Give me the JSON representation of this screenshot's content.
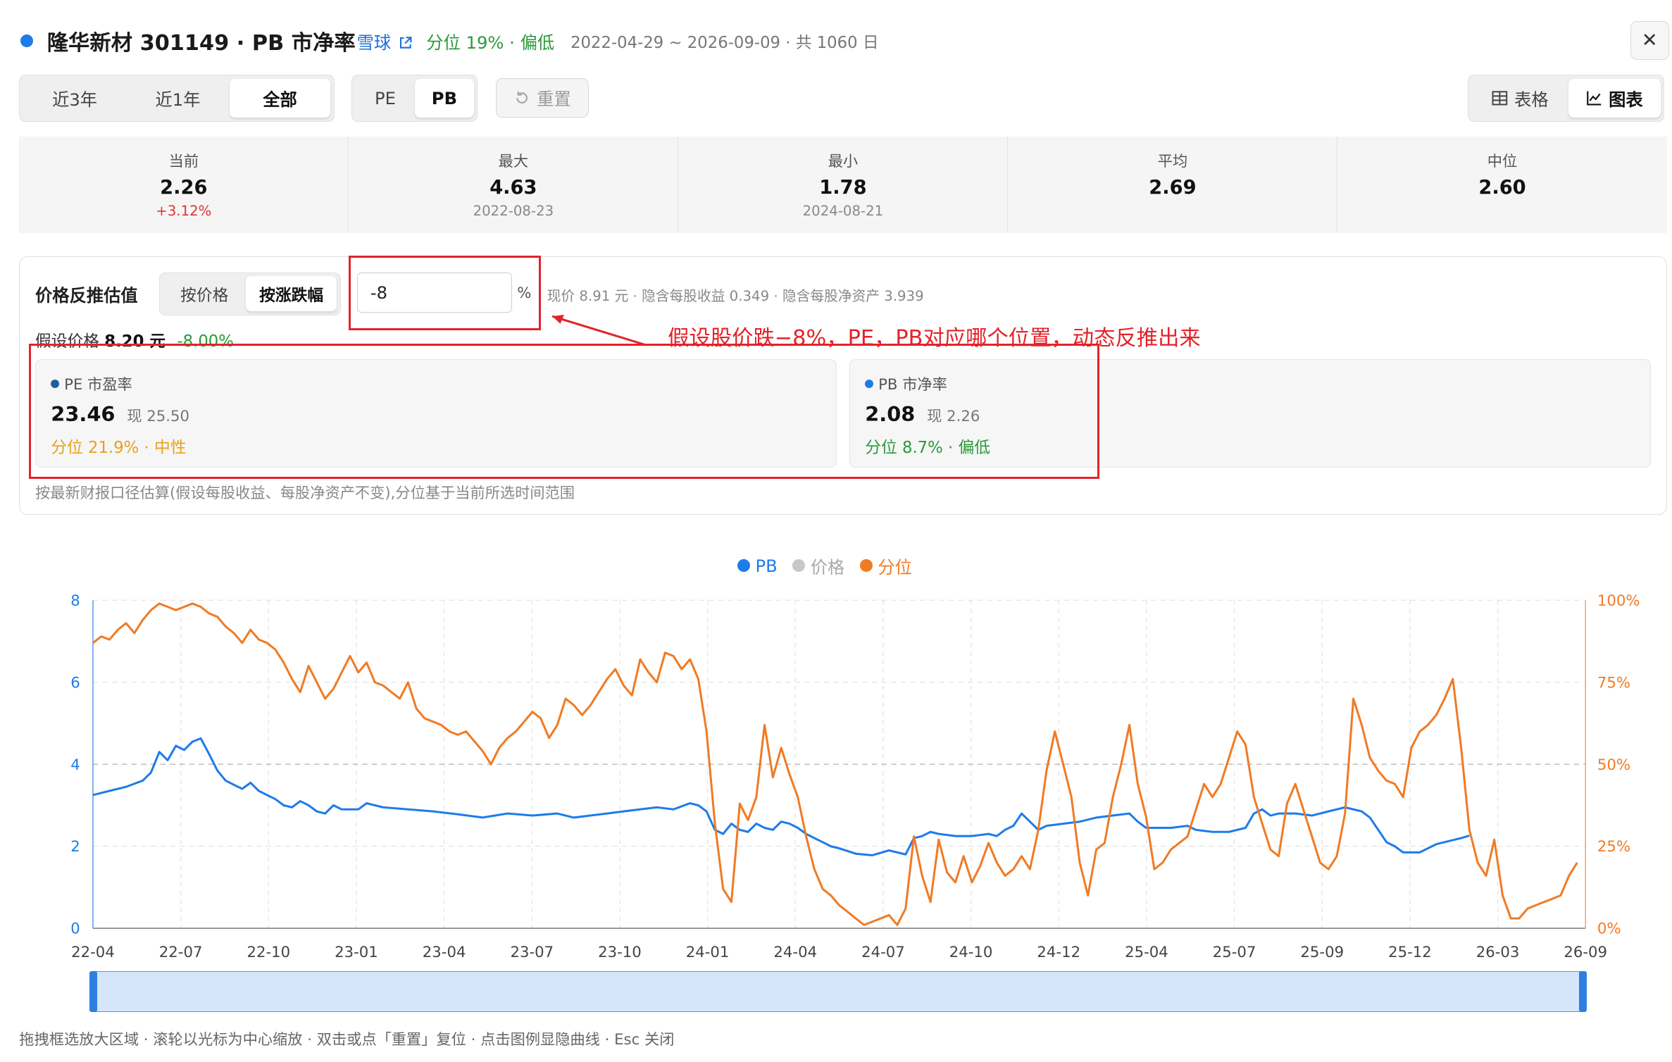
{
  "header": {
    "title": "隆华新材 301149 · PB 市净率",
    "source_link": "雪球",
    "percentile": "分位 19% · 偏低",
    "range": "2022-04-29 ~ 2026-09-09 · 共 1060 日",
    "close": "✕"
  },
  "toolbar": {
    "period_tabs": [
      "近3年",
      "近1年",
      "全部"
    ],
    "metric_tabs": [
      "PE",
      "PB"
    ],
    "reset": "重置",
    "view_table": "表格",
    "view_chart": "图表"
  },
  "stats": [
    {
      "label": "当前",
      "value": "2.26",
      "note": "+3.12%"
    },
    {
      "label": "最大",
      "value": "4.63",
      "note": "2022-08-23"
    },
    {
      "label": "最小",
      "value": "1.78",
      "note": "2024-08-21"
    },
    {
      "label": "平均",
      "value": "2.69",
      "note": ""
    },
    {
      "label": "中位",
      "value": "2.60",
      "note": ""
    }
  ],
  "valuation": {
    "title": "价格反推估值",
    "mode_tabs": [
      "按价格",
      "按涨跌幅"
    ],
    "input_value": "-8",
    "unit": "%",
    "info": "现价 8.91 元 · 隐含每股收益 0.349 · 隐含每股净资产 3.939",
    "assumed_label": "假设价格",
    "assumed_price": "8.20 元",
    "assumed_change": "-8.00%",
    "pe_card": {
      "head": "PE 市盈率",
      "value": "23.46",
      "now": "现 25.50",
      "pct": "分位 21.9% · 中性"
    },
    "pb_card": {
      "head": "PB 市净率",
      "value": "2.08",
      "now": "现 2.26",
      "pct": "分位 8.7% · 偏低"
    },
    "footnote": "按最新财报口径估算(假设每股收益、每股净资产不变),分位基于当前所选时间范围",
    "annotation": "假设股价跌−8%，PE，PB对应哪个位置，动态反推出来"
  },
  "colors": {
    "pb": "#1e7ce8",
    "price": "#bdbdbd",
    "pct": "#f07b25",
    "accent_red": "#e3232b",
    "green": "#2a9a3a",
    "orange_text": "#e8a01c"
  },
  "chart_data": {
    "type": "line",
    "legend": [
      "PB",
      "价格",
      "分位"
    ],
    "x_ticks": [
      "22-04",
      "22-07",
      "22-10",
      "23-01",
      "23-04",
      "23-07",
      "23-10",
      "24-01",
      "24-04",
      "24-07",
      "24-10",
      "24-12",
      "25-04",
      "25-07",
      "25-09",
      "25-12",
      "26-03",
      "26-09"
    ],
    "y_left_ticks": [
      "0",
      "2",
      "4",
      "6",
      "8"
    ],
    "y_right_ticks": [
      "0%",
      "25%",
      "50%",
      "75%",
      "100%"
    ],
    "ylim_left": [
      0,
      8
    ],
    "ylim_right": [
      0,
      100
    ],
    "series": [
      {
        "name": "PB",
        "axis": "left",
        "points": [
          [
            0,
            3.25
          ],
          [
            2,
            3.35
          ],
          [
            4,
            3.45
          ],
          [
            6,
            3.6
          ],
          [
            7,
            3.8
          ],
          [
            8,
            4.3
          ],
          [
            9,
            4.1
          ],
          [
            10,
            4.45
          ],
          [
            11,
            4.35
          ],
          [
            12,
            4.55
          ],
          [
            13,
            4.63
          ],
          [
            14,
            4.25
          ],
          [
            15,
            3.85
          ],
          [
            16,
            3.6
          ],
          [
            17,
            3.5
          ],
          [
            18,
            3.4
          ],
          [
            19,
            3.55
          ],
          [
            20,
            3.35
          ],
          [
            21,
            3.25
          ],
          [
            22,
            3.15
          ],
          [
            23,
            3.0
          ],
          [
            24,
            2.95
          ],
          [
            25,
            3.1
          ],
          [
            26,
            3.0
          ],
          [
            27,
            2.85
          ],
          [
            28,
            2.8
          ],
          [
            29,
            3.0
          ],
          [
            30,
            2.9
          ],
          [
            32,
            2.9
          ],
          [
            33,
            3.05
          ],
          [
            35,
            2.95
          ],
          [
            38,
            2.9
          ],
          [
            41,
            2.85
          ],
          [
            44,
            2.78
          ],
          [
            47,
            2.7
          ],
          [
            50,
            2.8
          ],
          [
            53,
            2.75
          ],
          [
            56,
            2.8
          ],
          [
            58,
            2.7
          ],
          [
            60,
            2.75
          ],
          [
            62,
            2.8
          ],
          [
            64,
            2.85
          ],
          [
            66,
            2.9
          ],
          [
            68,
            2.95
          ],
          [
            70,
            2.9
          ],
          [
            72,
            3.05
          ],
          [
            73,
            3.0
          ],
          [
            74,
            2.85
          ],
          [
            75,
            2.4
          ],
          [
            76,
            2.3
          ],
          [
            77,
            2.55
          ],
          [
            78,
            2.4
          ],
          [
            79,
            2.35
          ],
          [
            80,
            2.55
          ],
          [
            81,
            2.45
          ],
          [
            82,
            2.4
          ],
          [
            83,
            2.6
          ],
          [
            84,
            2.55
          ],
          [
            85,
            2.45
          ],
          [
            86,
            2.3
          ],
          [
            87,
            2.2
          ],
          [
            88,
            2.1
          ],
          [
            89,
            2.0
          ],
          [
            90,
            1.95
          ],
          [
            92,
            1.82
          ],
          [
            94,
            1.78
          ],
          [
            96,
            1.9
          ],
          [
            97,
            1.85
          ],
          [
            98,
            1.8
          ],
          [
            99,
            2.2
          ],
          [
            100,
            2.25
          ],
          [
            101,
            2.35
          ],
          [
            102,
            2.3
          ],
          [
            104,
            2.25
          ],
          [
            106,
            2.25
          ],
          [
            108,
            2.3
          ],
          [
            109,
            2.25
          ],
          [
            110,
            2.4
          ],
          [
            111,
            2.5
          ],
          [
            112,
            2.8
          ],
          [
            113,
            2.6
          ],
          [
            114,
            2.4
          ],
          [
            115,
            2.5
          ],
          [
            117,
            2.55
          ],
          [
            119,
            2.6
          ],
          [
            121,
            2.7
          ],
          [
            123,
            2.75
          ],
          [
            125,
            2.8
          ],
          [
            126,
            2.6
          ],
          [
            127,
            2.45
          ],
          [
            128,
            2.45
          ],
          [
            130,
            2.45
          ],
          [
            132,
            2.5
          ],
          [
            133,
            2.4
          ],
          [
            135,
            2.35
          ],
          [
            137,
            2.35
          ],
          [
            139,
            2.45
          ],
          [
            140,
            2.8
          ],
          [
            141,
            2.9
          ],
          [
            142,
            2.75
          ],
          [
            143,
            2.8
          ],
          [
            145,
            2.8
          ],
          [
            147,
            2.75
          ],
          [
            149,
            2.85
          ],
          [
            151,
            2.95
          ],
          [
            153,
            2.85
          ],
          [
            154,
            2.7
          ],
          [
            155,
            2.4
          ],
          [
            156,
            2.1
          ],
          [
            157,
            2.0
          ],
          [
            158,
            1.85
          ],
          [
            160,
            1.85
          ],
          [
            162,
            2.05
          ],
          [
            164,
            2.15
          ],
          [
            165,
            2.2
          ],
          [
            166,
            2.26
          ]
        ]
      },
      {
        "name": "分位",
        "axis": "right",
        "points": [
          [
            0,
            87
          ],
          [
            1,
            89
          ],
          [
            2,
            88
          ],
          [
            3,
            91
          ],
          [
            4,
            93
          ],
          [
            5,
            90
          ],
          [
            6,
            94
          ],
          [
            7,
            97
          ],
          [
            8,
            99
          ],
          [
            9,
            98
          ],
          [
            10,
            97
          ],
          [
            11,
            98
          ],
          [
            12,
            99
          ],
          [
            13,
            98
          ],
          [
            14,
            96
          ],
          [
            15,
            95
          ],
          [
            16,
            92
          ],
          [
            17,
            90
          ],
          [
            18,
            87
          ],
          [
            19,
            91
          ],
          [
            20,
            88
          ],
          [
            21,
            87
          ],
          [
            22,
            85
          ],
          [
            23,
            81
          ],
          [
            24,
            76
          ],
          [
            25,
            72
          ],
          [
            26,
            80
          ],
          [
            27,
            75
          ],
          [
            28,
            70
          ],
          [
            29,
            73
          ],
          [
            30,
            78
          ],
          [
            31,
            83
          ],
          [
            32,
            78
          ],
          [
            33,
            81
          ],
          [
            34,
            75
          ],
          [
            35,
            74
          ],
          [
            36,
            72
          ],
          [
            37,
            70
          ],
          [
            38,
            75
          ],
          [
            39,
            67
          ],
          [
            40,
            64
          ],
          [
            41,
            63
          ],
          [
            42,
            62
          ],
          [
            43,
            60
          ],
          [
            44,
            59
          ],
          [
            45,
            60
          ],
          [
            46,
            57
          ],
          [
            47,
            54
          ],
          [
            48,
            50
          ],
          [
            49,
            55
          ],
          [
            50,
            58
          ],
          [
            51,
            60
          ],
          [
            52,
            63
          ],
          [
            53,
            66
          ],
          [
            54,
            64
          ],
          [
            55,
            58
          ],
          [
            56,
            62
          ],
          [
            57,
            70
          ],
          [
            58,
            68
          ],
          [
            59,
            65
          ],
          [
            60,
            68
          ],
          [
            61,
            72
          ],
          [
            62,
            76
          ],
          [
            63,
            79
          ],
          [
            64,
            74
          ],
          [
            65,
            71
          ],
          [
            66,
            82
          ],
          [
            67,
            78
          ],
          [
            68,
            75
          ],
          [
            69,
            84
          ],
          [
            70,
            83
          ],
          [
            71,
            79
          ],
          [
            72,
            82
          ],
          [
            73,
            76
          ],
          [
            74,
            60
          ],
          [
            75,
            32
          ],
          [
            76,
            12
          ],
          [
            77,
            8
          ],
          [
            78,
            38
          ],
          [
            79,
            33
          ],
          [
            80,
            40
          ],
          [
            81,
            62
          ],
          [
            82,
            46
          ],
          [
            83,
            55
          ],
          [
            84,
            47
          ],
          [
            85,
            40
          ],
          [
            86,
            28
          ],
          [
            87,
            18
          ],
          [
            88,
            12
          ],
          [
            89,
            10
          ],
          [
            90,
            7
          ],
          [
            91,
            5
          ],
          [
            92,
            3
          ],
          [
            93,
            1
          ],
          [
            94,
            2
          ],
          [
            95,
            3
          ],
          [
            96,
            4
          ],
          [
            97,
            1
          ],
          [
            98,
            6
          ],
          [
            99,
            28
          ],
          [
            100,
            16
          ],
          [
            101,
            8
          ],
          [
            102,
            27
          ],
          [
            103,
            17
          ],
          [
            104,
            14
          ],
          [
            105,
            22
          ],
          [
            106,
            14
          ],
          [
            107,
            19
          ],
          [
            108,
            26
          ],
          [
            109,
            20
          ],
          [
            110,
            16
          ],
          [
            111,
            18
          ],
          [
            112,
            22
          ],
          [
            113,
            18
          ],
          [
            114,
            30
          ],
          [
            115,
            48
          ],
          [
            116,
            60
          ],
          [
            117,
            50
          ],
          [
            118,
            40
          ],
          [
            119,
            20
          ],
          [
            120,
            10
          ],
          [
            121,
            24
          ],
          [
            122,
            26
          ],
          [
            123,
            40
          ],
          [
            124,
            50
          ],
          [
            125,
            62
          ],
          [
            126,
            44
          ],
          [
            127,
            34
          ],
          [
            128,
            18
          ],
          [
            129,
            20
          ],
          [
            130,
            24
          ],
          [
            131,
            26
          ],
          [
            132,
            28
          ],
          [
            133,
            36
          ],
          [
            134,
            44
          ],
          [
            135,
            40
          ],
          [
            136,
            44
          ],
          [
            137,
            52
          ],
          [
            138,
            60
          ],
          [
            139,
            56
          ],
          [
            140,
            40
          ],
          [
            141,
            32
          ],
          [
            142,
            24
          ],
          [
            143,
            22
          ],
          [
            144,
            38
          ],
          [
            145,
            44
          ],
          [
            146,
            36
          ],
          [
            147,
            28
          ],
          [
            148,
            20
          ],
          [
            149,
            18
          ],
          [
            150,
            22
          ],
          [
            151,
            35
          ],
          [
            152,
            70
          ],
          [
            153,
            62
          ],
          [
            154,
            52
          ],
          [
            155,
            48
          ],
          [
            156,
            45
          ],
          [
            157,
            44
          ],
          [
            158,
            40
          ],
          [
            159,
            55
          ],
          [
            160,
            60
          ],
          [
            161,
            62
          ],
          [
            162,
            65
          ],
          [
            163,
            70
          ],
          [
            164,
            76
          ],
          [
            165,
            55
          ],
          [
            166,
            30
          ],
          [
            167,
            20
          ],
          [
            168,
            16
          ],
          [
            169,
            27
          ],
          [
            170,
            10
          ],
          [
            171,
            3
          ],
          [
            172,
            3
          ],
          [
            173,
            6
          ],
          [
            174,
            7
          ],
          [
            175,
            8
          ],
          [
            176,
            9
          ],
          [
            177,
            10
          ],
          [
            178,
            16
          ],
          [
            179,
            20
          ]
        ]
      }
    ]
  },
  "footer": "拖拽框选放大区域 · 滚轮以光标为中心缩放 · 双击或点「重置」复位 · 点击图例显隐曲线 · Esc 关闭"
}
